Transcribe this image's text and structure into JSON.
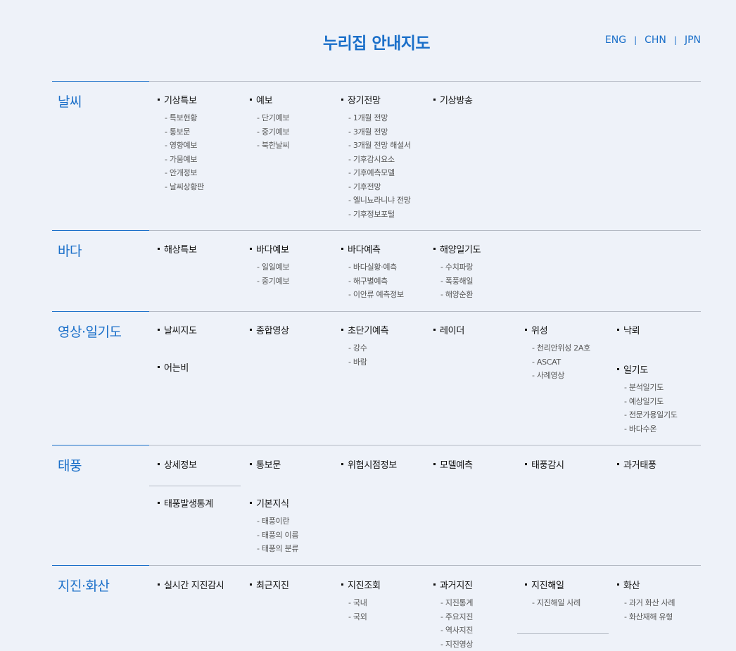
{
  "header": {
    "title": "누리집 안내지도",
    "languages": [
      "ENG",
      "CHN",
      "JPN"
    ],
    "separator": "|"
  },
  "sections": [
    {
      "category": "날씨",
      "groups": [
        {
          "title": "기상특보",
          "items": [
            "특보현황",
            "통보문",
            "영향예보",
            "가뭄예보",
            "안개정보",
            "날씨상황판"
          ]
        },
        {
          "title": "예보",
          "items": [
            "단기예보",
            "중기예보",
            "북한날씨"
          ]
        },
        {
          "title": "장기전망",
          "items": [
            "1개월 전망",
            "3개월 전망",
            "3개월 전망 해설서",
            "기후감시요소",
            "기후예측모델",
            "기후전망",
            "엘니뇨라니냐 전망",
            "기후정보포털"
          ]
        },
        {
          "title": "기상방송",
          "items": []
        }
      ]
    },
    {
      "category": "바다",
      "groups": [
        {
          "title": "해상특보",
          "items": []
        },
        {
          "title": "바다예보",
          "items": [
            "일일예보",
            "중기예보"
          ]
        },
        {
          "title": "바다예측",
          "items": [
            "바다실황·예측",
            "해구별예측",
            "이안류 예측정보"
          ]
        },
        {
          "title": "해양일기도",
          "items": [
            "수치파랑",
            "폭풍해일",
            "해양순환"
          ]
        }
      ]
    },
    {
      "category": "영상·일기도",
      "groups": [
        {
          "title": "날씨지도",
          "items": []
        },
        {
          "title": "종합영상",
          "items": []
        },
        {
          "title": "초단기예측",
          "items": [
            "강수",
            "바람"
          ]
        },
        {
          "title": "레이더",
          "items": []
        },
        {
          "title": "위성",
          "items": [
            "천리안위성 2A호",
            "ASCAT",
            "사례영상"
          ]
        },
        {
          "title": "낙뢰",
          "items": []
        },
        {
          "title": "어는비",
          "items": []
        },
        {
          "title": "일기도",
          "items": [
            "분석일기도",
            "예상일기도",
            "전문가용일기도",
            "바다수온"
          ]
        }
      ]
    },
    {
      "category": "태풍",
      "groups": [
        {
          "title": "상세정보",
          "items": []
        },
        {
          "title": "통보문",
          "items": []
        },
        {
          "title": "위험시점정보",
          "items": []
        },
        {
          "title": "모델예측",
          "items": []
        },
        {
          "title": "태풍감시",
          "items": []
        },
        {
          "title": "과거태풍",
          "items": []
        },
        {
          "title": "태풍발생통계",
          "items": []
        },
        {
          "title": "기본지식",
          "items": [
            "태풍이란",
            "태풍의 이름",
            "태풍의 분류"
          ]
        }
      ]
    },
    {
      "category": "지진·화산",
      "groups": [
        {
          "title": "실시간 지진감시",
          "items": []
        },
        {
          "title": "최근지진",
          "items": []
        },
        {
          "title": "지진조회",
          "items": [
            "국내",
            "국외"
          ]
        },
        {
          "title": "과거지진",
          "items": [
            "지진통계",
            "주요지진",
            "역사지진",
            "지진영상"
          ]
        },
        {
          "title": "지진해일",
          "items": [
            "지진해일 사례"
          ]
        },
        {
          "title": "화산",
          "items": [
            "과거 화산 사례",
            "화산재해 유형"
          ]
        }
      ]
    }
  ]
}
